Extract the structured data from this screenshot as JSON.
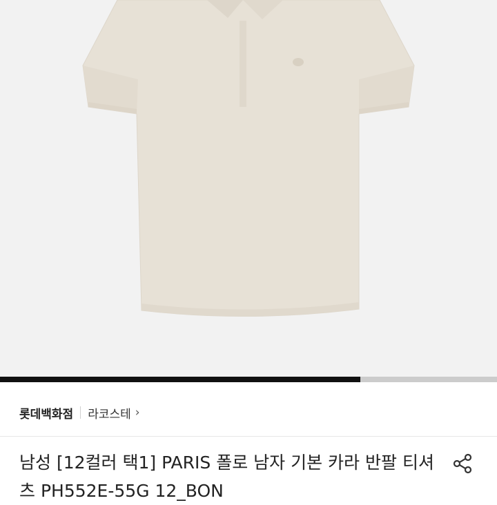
{
  "product": {
    "image_alt": "polo shirt product photo",
    "shirt_color": "#e7e1d6",
    "image_bg": "#f2f2f2",
    "carousel_progress": 0.725
  },
  "seller": {
    "store_name": "롯데백화점",
    "brand_name": "라코스테",
    "brand_chevron": "›"
  },
  "title": "남성 [12컬러 택1] PARIS 폴로 남자 기본 카라 반팔 티셔츠 PH552E-55G 12_BON",
  "icons": {
    "share": "share-icon"
  }
}
